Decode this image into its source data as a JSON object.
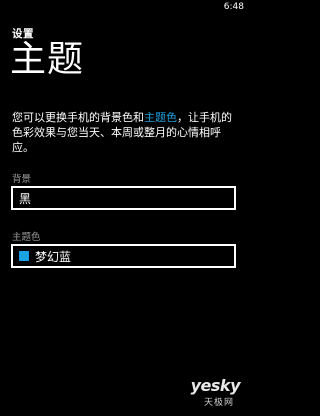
{
  "status_bar": {
    "time": "6:48"
  },
  "header": {
    "app_title": "设置",
    "page_title": "主题"
  },
  "description": {
    "part1": "您可以更换手机的背景色和",
    "accent_link": "主题色",
    "part2": "，让手机的色彩效果与您当天、本周或整月的心情相呼应。"
  },
  "background": {
    "label": "背景",
    "value": "黑"
  },
  "theme_color": {
    "label": "主题色",
    "value": "梦幻蓝",
    "swatch_color": "#1ba1e2"
  },
  "watermark": {
    "brand": "yesky",
    "sub": "天极网"
  },
  "colors": {
    "background": "#000000",
    "text": "#ffffff",
    "accent": "#1ba1e2",
    "label": "#9a9a9a"
  }
}
